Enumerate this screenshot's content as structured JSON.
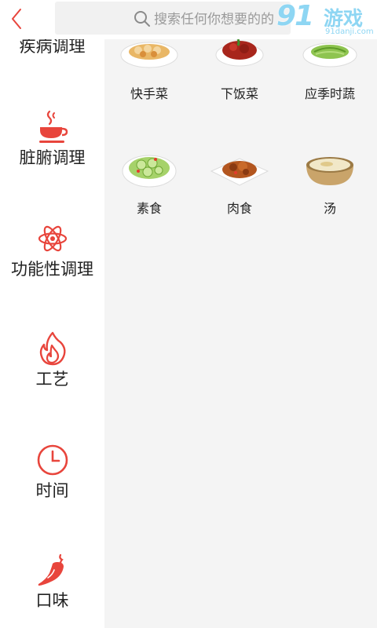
{
  "header": {
    "search_placeholder": "搜索任何你想要的的"
  },
  "watermark": {
    "brand_digits": "91",
    "brand_cn": "游戏",
    "url": "91danji.com"
  },
  "sidebar": {
    "items": [
      {
        "label": "疾病调理",
        "icon": "medicine-icon"
      },
      {
        "label": "脏腑调理",
        "icon": "cup-icon"
      },
      {
        "label": "功能性调理",
        "icon": "atom-icon"
      },
      {
        "label": "工艺",
        "icon": "fire-icon"
      },
      {
        "label": "时间",
        "icon": "clock-icon"
      },
      {
        "label": "口味",
        "icon": "chili-icon"
      }
    ]
  },
  "grid": {
    "items": [
      {
        "label": "快手菜"
      },
      {
        "label": "下饭菜"
      },
      {
        "label": "应季时蔬"
      },
      {
        "label": "素食"
      },
      {
        "label": "肉食"
      },
      {
        "label": "汤"
      }
    ]
  },
  "colors": {
    "accent": "#e8453c",
    "sidebar_bg": "#ffffff",
    "content_bg": "#f4f4f4"
  }
}
